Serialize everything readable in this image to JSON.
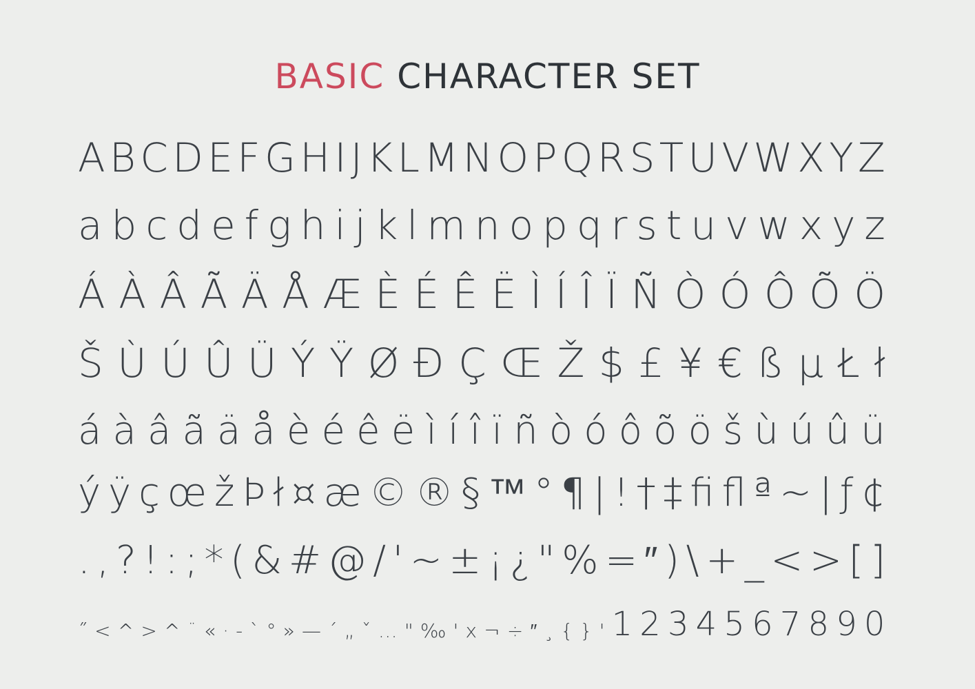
{
  "title": {
    "accent": "BASIC",
    "rest": "CHARACTER SET",
    "accent_color": "#cc4a5d",
    "text_color": "#2e3338"
  },
  "rows": [
    [
      "A",
      "B",
      "C",
      "D",
      "E",
      "F",
      "G",
      "H",
      "I",
      "J",
      "K",
      "L",
      "M",
      "N",
      "O",
      "P",
      "Q",
      "R",
      "S",
      "T",
      "U",
      "V",
      "W",
      "X",
      "Y",
      "Z"
    ],
    [
      "a",
      "b",
      "c",
      "d",
      "e",
      "f",
      "g",
      "h",
      "i",
      "j",
      "k",
      "l",
      "m",
      "n",
      "o",
      "p",
      "q",
      "r",
      "s",
      "t",
      "u",
      "v",
      "w",
      "x",
      "y",
      "z"
    ],
    [
      "Á",
      "À",
      "Â",
      "Ã",
      "Ä",
      "Å",
      "Æ",
      "È",
      "É",
      "Ê",
      "Ë",
      "Ì",
      "Í",
      "Î",
      "Ï",
      "Ñ",
      "Ò",
      "Ó",
      "Ô",
      "Õ",
      "Ö"
    ],
    [
      "Š",
      "Ù",
      "Ú",
      "Û",
      "Ü",
      "Ý",
      "Ÿ",
      "Ø",
      "Đ",
      "Ç",
      "Œ",
      "Ž",
      "$",
      "£",
      "¥",
      "€",
      "ß",
      "µ",
      "Ł",
      "ł"
    ],
    [
      "á",
      "à",
      "â",
      "ã",
      "ä",
      "å",
      "è",
      "é",
      "ê",
      "ë",
      "ì",
      "í",
      "î",
      "ï",
      "ñ",
      "ò",
      "ó",
      "ô",
      "õ",
      "ö",
      "š",
      "ù",
      "ú",
      "û",
      "ü"
    ],
    [
      "ý",
      "ÿ",
      "ç",
      "œ",
      "ž",
      "Þ",
      "ł",
      "¤",
      "æ",
      "©",
      "®",
      "§",
      "™",
      "°",
      "¶",
      "|",
      "!",
      "†",
      "‡",
      "ﬁ",
      "ﬂ",
      "ª",
      "~",
      "|",
      "ƒ",
      "¢"
    ],
    [
      ".",
      ",",
      "?",
      "!",
      ":",
      ";",
      "*",
      "(",
      "&",
      "#",
      "@",
      "/",
      "'",
      "~",
      "±",
      "¡",
      "¿",
      "\"",
      "%",
      "=",
      "″",
      ")",
      "\\",
      "+",
      "_",
      "<",
      ">",
      "[",
      "]"
    ],
    [
      "˝",
      "<",
      "^",
      ">",
      "^",
      "¨",
      "«",
      "·",
      "-",
      "`",
      "°",
      "»",
      "—",
      "´",
      "„",
      "ˇ",
      "…",
      "\"",
      "‰",
      "'",
      "x",
      "¬",
      "÷",
      "″",
      "¸",
      "{",
      "}",
      "'",
      "1",
      "2",
      "3",
      "4",
      "5",
      "6",
      "7",
      "8",
      "9",
      "0"
    ]
  ]
}
